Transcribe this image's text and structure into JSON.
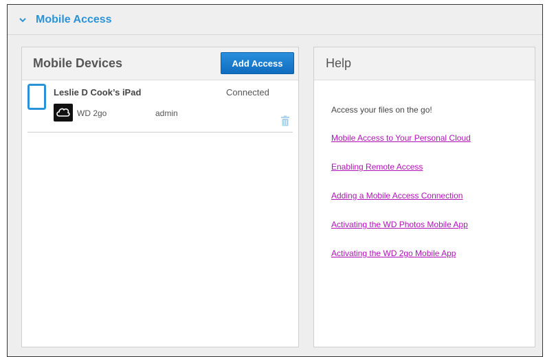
{
  "section": {
    "title": "Mobile Access",
    "expand_icon": "chevron-down-icon"
  },
  "devices_panel": {
    "title": "Mobile Devices",
    "add_button_label": "Add Access",
    "devices": [
      {
        "name": "Leslie D Cook’s iPad",
        "status": "Connected",
        "device_icon": "ipad-icon",
        "app_icon": "cloud-icon",
        "app_name": "WD 2go",
        "user": "admin",
        "delete_icon": "trash-icon"
      }
    ]
  },
  "help_panel": {
    "title": "Help",
    "intro": "Access your files on the go!",
    "links": [
      "Mobile Access to Your Personal Cloud",
      "Enabling Remote Access",
      "Adding a Mobile Access Connection",
      "Activating the WD Photos Mobile App",
      "Activating the WD 2go Mobile App"
    ]
  },
  "colors": {
    "accent": "#2b92d8",
    "button": "#1a7acc",
    "link": "#b012b8"
  }
}
